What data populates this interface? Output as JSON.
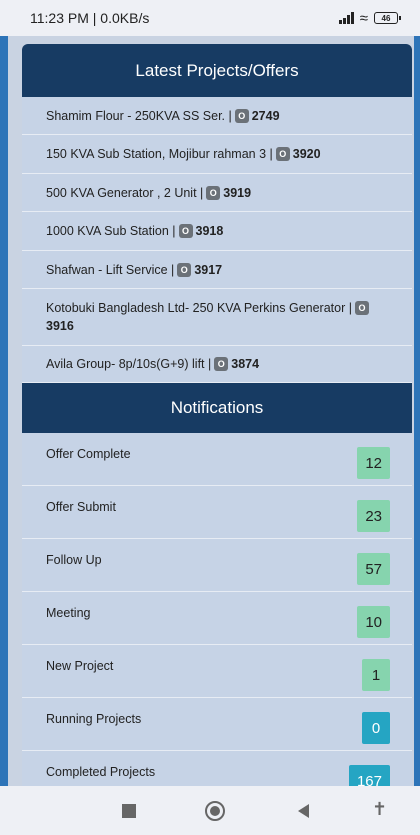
{
  "status_bar": {
    "time_net": "11:23 PM | 0.0KB/s",
    "battery": "46"
  },
  "projects": {
    "title": "Latest Projects/Offers",
    "badge_glyph": "O",
    "items": [
      {
        "text": "Shamim Flour - 250KVA SS Ser. |",
        "id": "2749"
      },
      {
        "text": "150 KVA Sub Station, Mojibur rahman 3 |",
        "id": "3920"
      },
      {
        "text": "500 KVA Generator , 2 Unit |",
        "id": "3919"
      },
      {
        "text": "1000 KVA Sub Station |",
        "id": "3918"
      },
      {
        "text": "Shafwan - Lift Service |",
        "id": "3917"
      },
      {
        "text": "Kotobuki Bangladesh Ltd- 250 KVA Perkins Generator |",
        "id": "3916"
      },
      {
        "text": "Avila Group- 8p/10s(G+9) lift |",
        "id": "3874"
      }
    ]
  },
  "notifications": {
    "title": "Notifications",
    "items": [
      {
        "label": "Offer Complete",
        "count": "12"
      },
      {
        "label": "Offer Submit",
        "count": "23"
      },
      {
        "label": "Follow Up",
        "count": "57"
      },
      {
        "label": "Meeting",
        "count": "10"
      },
      {
        "label": "New Project",
        "count": "1"
      },
      {
        "label": "Running Projects",
        "count": "0"
      },
      {
        "label": "Completed Projects",
        "count": "167"
      }
    ]
  },
  "nav_bar": {
    "icons": [
      "recent-apps-icon",
      "home-icon",
      "back-icon",
      "accessibility-icon"
    ]
  },
  "colors": {
    "header_bg": "#173b63",
    "count_green": "#86d4ae",
    "count_teal": "#25a5c3"
  }
}
